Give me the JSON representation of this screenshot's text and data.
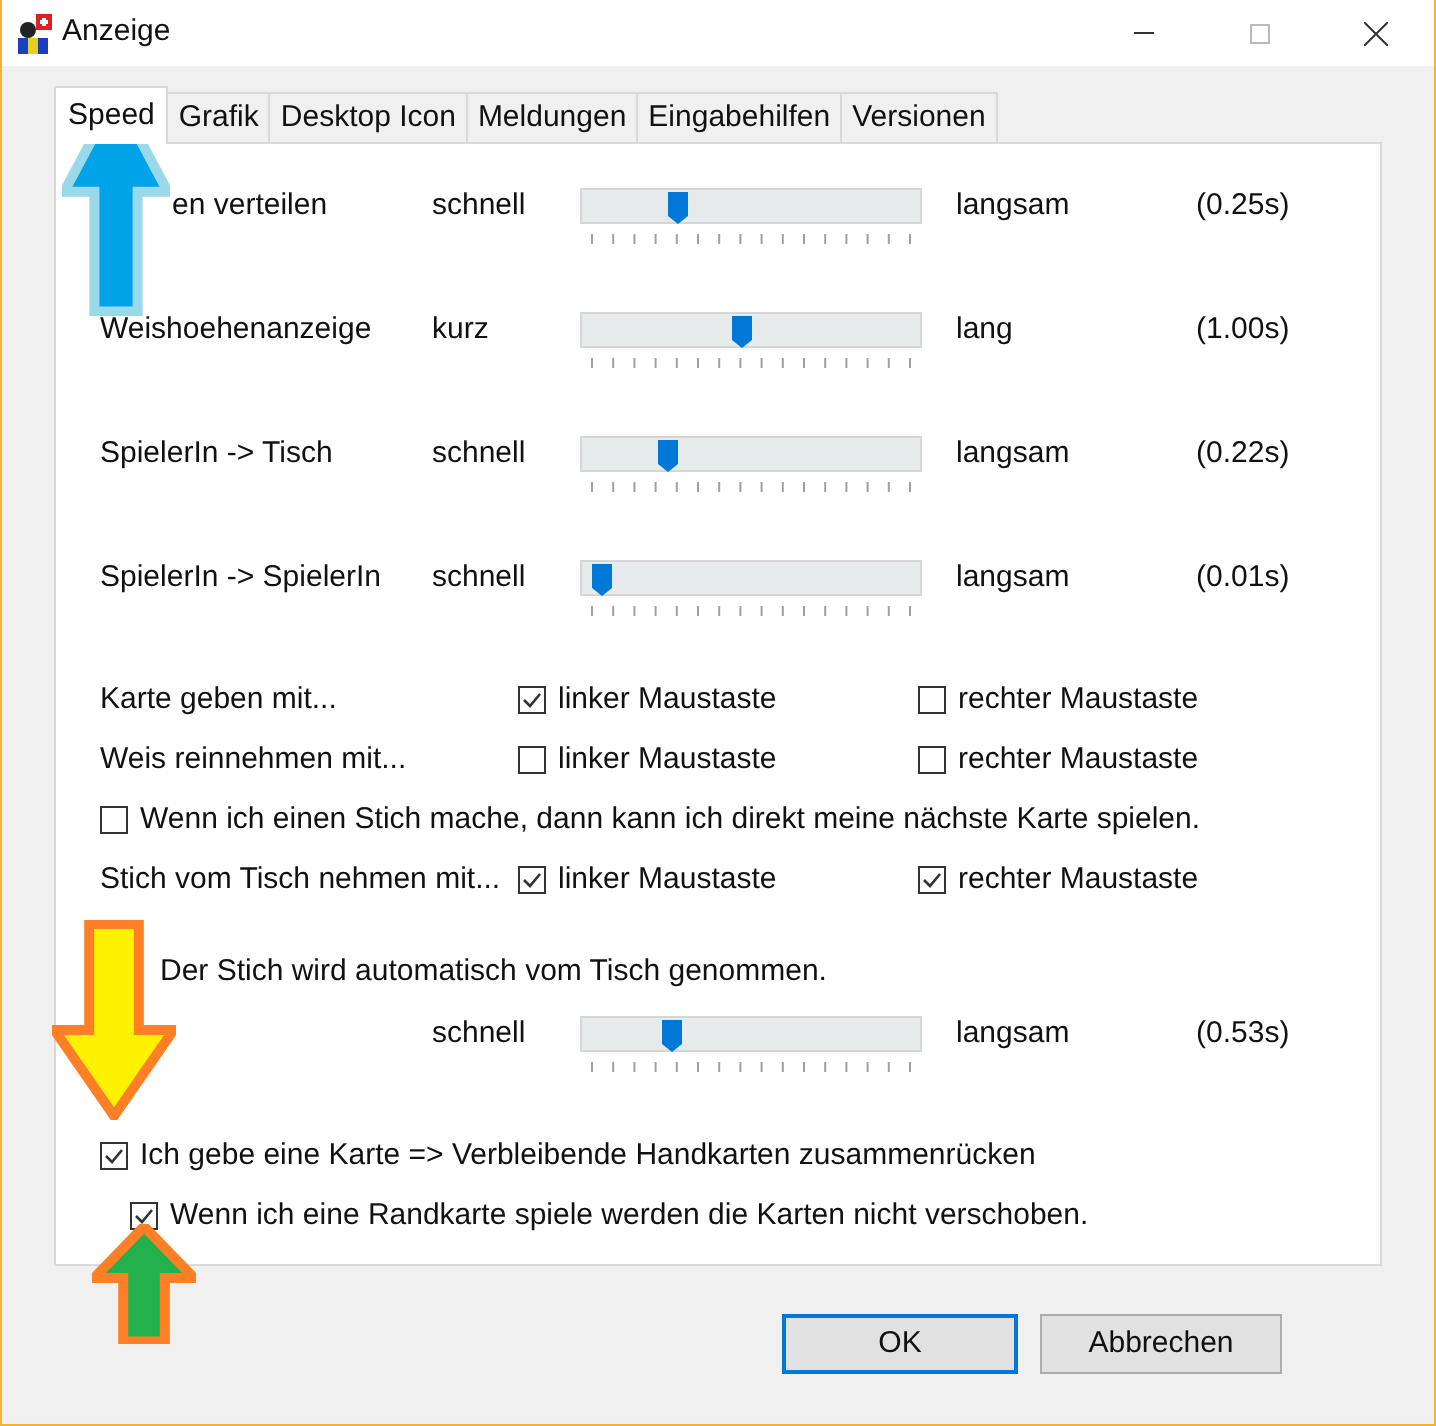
{
  "window": {
    "title": "Anzeige"
  },
  "tabs": [
    {
      "label": "Speed",
      "selected": true
    },
    {
      "label": "Grafik",
      "selected": false
    },
    {
      "label": "Desktop Icon",
      "selected": false
    },
    {
      "label": "Meldungen",
      "selected": false
    },
    {
      "label": "Eingabehilfen",
      "selected": false
    },
    {
      "label": "Versionen",
      "selected": false
    }
  ],
  "rows": [
    {
      "kind": "slider",
      "label": "en verteilen",
      "min": "schnell",
      "max": "langsam",
      "value": "(0.25s)",
      "level": 0.27
    },
    {
      "kind": "slider",
      "label": "Weishoehenanzeige",
      "min": "kurz",
      "max": "lang",
      "value": "(1.00s)",
      "level": 0.47
    },
    {
      "kind": "slider",
      "label": "SpielerIn -> Tisch",
      "min": "schnell",
      "max": "langsam",
      "value": "(0.22s)",
      "level": 0.24
    },
    {
      "kind": "slider",
      "label": "SpielerIn -> SpielerIn",
      "min": "schnell",
      "max": "langsam",
      "value": "(0.01s)",
      "level": 0.03
    },
    {
      "kind": "options",
      "label": "Karte geben mit...",
      "options": [
        {
          "label": "linker Maustaste",
          "checked": true
        },
        {
          "label": "rechter Maustaste",
          "checked": false
        }
      ]
    },
    {
      "kind": "options",
      "label": "Weis reinnehmen mit...",
      "options": [
        {
          "label": "linker Maustaste",
          "checked": false
        },
        {
          "label": "rechter Maustaste",
          "checked": false
        }
      ]
    },
    {
      "kind": "checkbox",
      "label": "Wenn ich einen Stich mache, dann kann ich direkt meine nächste Karte spielen.",
      "checked": false
    },
    {
      "kind": "options",
      "label": "Stich vom Tisch nehmen mit...",
      "options": [
        {
          "label": "linker Maustaste",
          "checked": true
        },
        {
          "label": "rechter Maustaste",
          "checked": true
        }
      ]
    },
    {
      "kind": "note",
      "label": "Der Stich wird automatisch vom Tisch genommen."
    },
    {
      "kind": "slider",
      "min": "schnell",
      "max": "langsam",
      "value": "(0.53s)",
      "level": 0.25
    },
    {
      "kind": "checkbox",
      "label": "Ich gebe eine Karte => Verbleibende Handkarten zusammenrücken",
      "checked": true,
      "children": [
        {
          "label": "Wenn ich eine Randkarte spiele werden die Karten nicht verschoben.",
          "checked": true
        }
      ]
    }
  ],
  "buttons": [
    {
      "label": "OK",
      "default": true
    },
    {
      "label": "Abbrechen",
      "default": false
    }
  ]
}
